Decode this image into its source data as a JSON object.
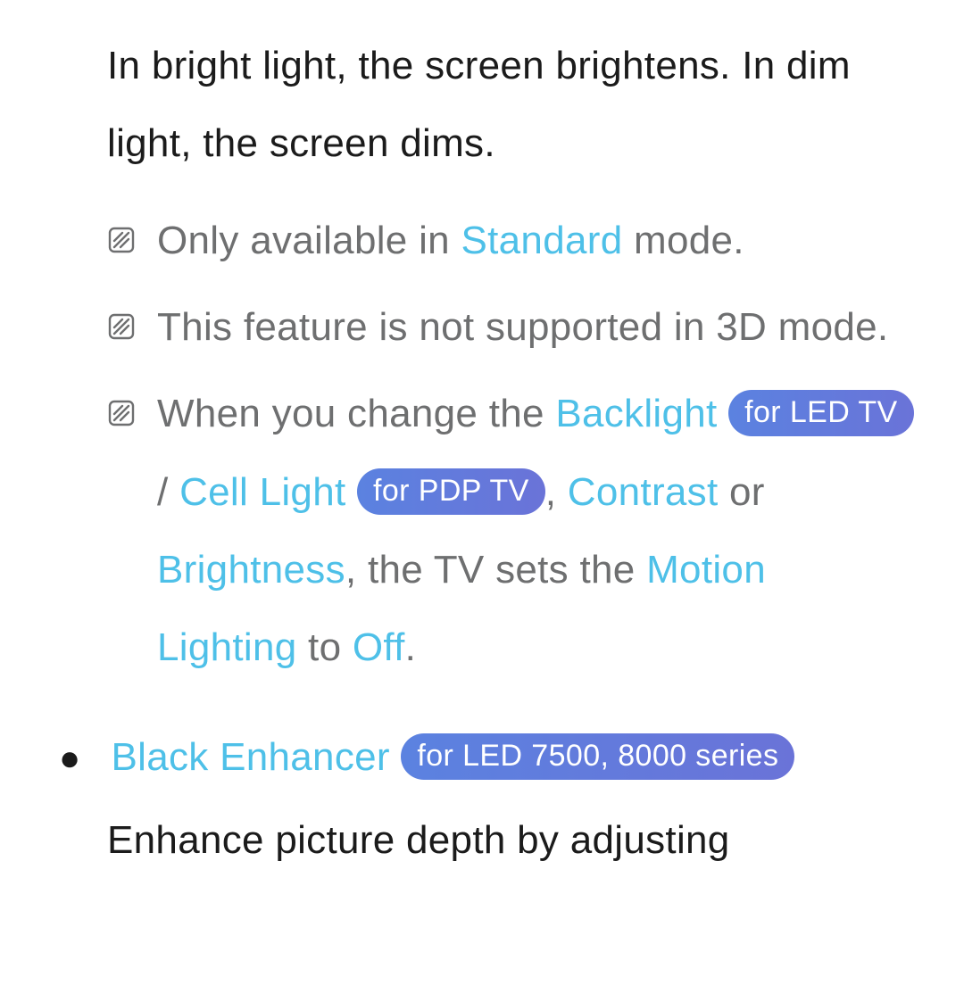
{
  "intro": "In bright light, the screen brightens. In dim light, the screen dims.",
  "notes": {
    "n1": {
      "a": "Only available in ",
      "b": "Standard",
      "c": " mode."
    },
    "n2": "This feature is not supported in 3D mode.",
    "n3": {
      "a": "When you change the ",
      "backlight": "Backlight",
      "pill_led": "for LED TV",
      "slash": " / ",
      "cell": "Cell Light",
      "space1": " ",
      "pill_pdp": "for PDP TV",
      "comma1": ", ",
      "contrast": "Contrast",
      "or": " or ",
      "brightness": "Brightness",
      "mid": ", the TV sets the ",
      "motion": "Motion Lighting",
      "to": " to ",
      "off": "Off",
      "period": "."
    }
  },
  "black": {
    "bullet": "●",
    "title": "Black Enhancer",
    "space": " ",
    "pill": "for LED 7500, 8000 series",
    "desc": "Enhance picture depth by adjusting"
  }
}
